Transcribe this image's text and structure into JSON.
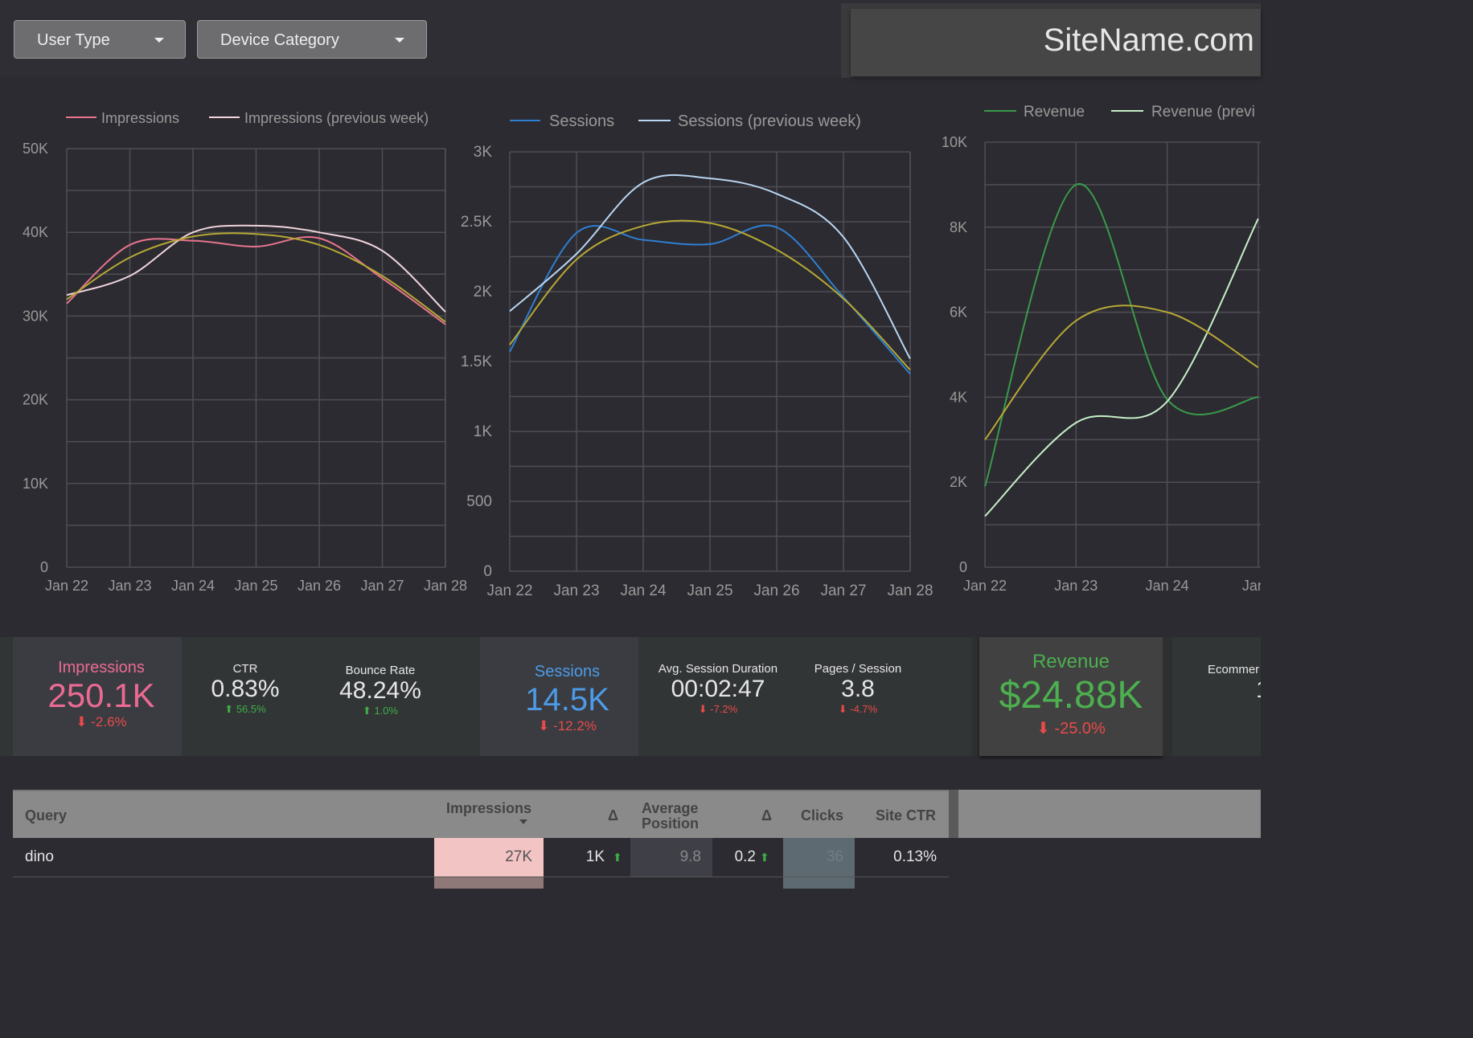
{
  "filters": [
    {
      "label": "User Type"
    },
    {
      "label": "Device Category"
    }
  ],
  "brand": "SiteName.com",
  "charts": {
    "x_labels": [
      "Jan 22",
      "Jan 23",
      "Jan 24",
      "Jan 25",
      "Jan 26",
      "Jan 27",
      "Jan 28"
    ],
    "x_labels_revenue": [
      "Jan 22",
      "Jan 23",
      "Jan 24",
      "Jan"
    ],
    "legend": {
      "impressions": "Impressions",
      "impressions_prev": "Impressions (previous week)",
      "sessions": "Sessions",
      "sessions_prev": "Sessions (previous week)",
      "revenue": "Revenue",
      "revenue_prev": "Revenue (previ"
    },
    "y_ticks": {
      "impressions": [
        "50K",
        "40K",
        "30K",
        "20K",
        "10K",
        "0"
      ],
      "sessions": [
        "3K",
        "2.5K",
        "2K",
        "1.5K",
        "1K",
        "500",
        "0"
      ],
      "revenue": [
        "10K",
        "8K",
        "6K",
        "4K",
        "2K",
        "0"
      ]
    }
  },
  "chart_data": [
    {
      "type": "line",
      "x": [
        "Jan 22",
        "Jan 23",
        "Jan 24",
        "Jan 25",
        "Jan 26",
        "Jan 27",
        "Jan 28"
      ],
      "ylim": [
        0,
        50000
      ],
      "series": [
        {
          "name": "Impressions",
          "color": "#e8748e",
          "values": [
            31500,
            38500,
            39000,
            38300,
            39300,
            34500,
            29000
          ]
        },
        {
          "name": "Impressions (previous week)",
          "color": "#f2d4dc",
          "values": [
            32500,
            34800,
            40000,
            40800,
            40000,
            37800,
            30500
          ]
        },
        {
          "name": "",
          "color": "#b7a834",
          "values": [
            32000,
            37000,
            39500,
            39800,
            38500,
            34800,
            29300
          ]
        }
      ]
    },
    {
      "type": "line",
      "x": [
        "Jan 22",
        "Jan 23",
        "Jan 24",
        "Jan 25",
        "Jan 26",
        "Jan 27",
        "Jan 28"
      ],
      "ylim": [
        0,
        3000
      ],
      "series": [
        {
          "name": "Sessions",
          "color": "#2f7fd2",
          "values": [
            1570,
            2420,
            2370,
            2340,
            2460,
            1960,
            1410
          ]
        },
        {
          "name": "Sessions (previous week)",
          "color": "#b9d5f2",
          "values": [
            1860,
            2270,
            2780,
            2810,
            2700,
            2390,
            1520
          ]
        },
        {
          "name": "",
          "color": "#b7a834",
          "values": [
            1620,
            2230,
            2470,
            2490,
            2300,
            1950,
            1440
          ]
        }
      ]
    },
    {
      "type": "line",
      "x": [
        "Jan 22",
        "Jan 23",
        "Jan 24",
        "Jan"
      ],
      "ylim": [
        0,
        10000
      ],
      "series": [
        {
          "name": "Revenue",
          "color": "#3a9a49",
          "values": [
            1900,
            9000,
            3950,
            4000
          ]
        },
        {
          "name": "Revenue (previ",
          "color": "#c7f0c8",
          "values": [
            1200,
            3400,
            3900,
            8200
          ]
        },
        {
          "name": "",
          "color": "#b7a834",
          "values": [
            3000,
            5800,
            6000,
            4700
          ]
        }
      ]
    }
  ],
  "kpis": {
    "impressions": {
      "label": "Impressions",
      "value": "250.1K",
      "delta": "-2.6%"
    },
    "ctr": {
      "label": "CTR",
      "value": "0.83%",
      "delta": "56.5%"
    },
    "bounce": {
      "label": "Bounce Rate",
      "value": "48.24%",
      "delta": "1.0%"
    },
    "sessions": {
      "label": "Sessions",
      "value": "14.5K",
      "delta": "-12.2%"
    },
    "duration": {
      "label": "Avg. Session Duration",
      "value": "00:02:47",
      "delta": "-7.2%"
    },
    "pages": {
      "label": "Pages / Session",
      "value": "3.8",
      "delta": "-4.7%"
    },
    "revenue": {
      "label": "Revenue",
      "value": "$24.88K",
      "delta": "-25.0%"
    },
    "ecommerce": {
      "label": "Ecommer",
      "value": "1"
    }
  },
  "table": {
    "headers": {
      "query": "Query",
      "impressions": "Impressions",
      "delta1": "Δ",
      "avg_pos_1": "Average",
      "avg_pos_2": "Position",
      "delta2": "Δ",
      "clicks": "Clicks",
      "site_ctr": "Site CTR"
    },
    "rows": [
      {
        "query": "dino",
        "impressions": "27K",
        "delta1": "1K",
        "avg_pos": "9.8",
        "delta2": "0.2",
        "clicks": "36",
        "site_ctr": "0.13%"
      }
    ]
  }
}
